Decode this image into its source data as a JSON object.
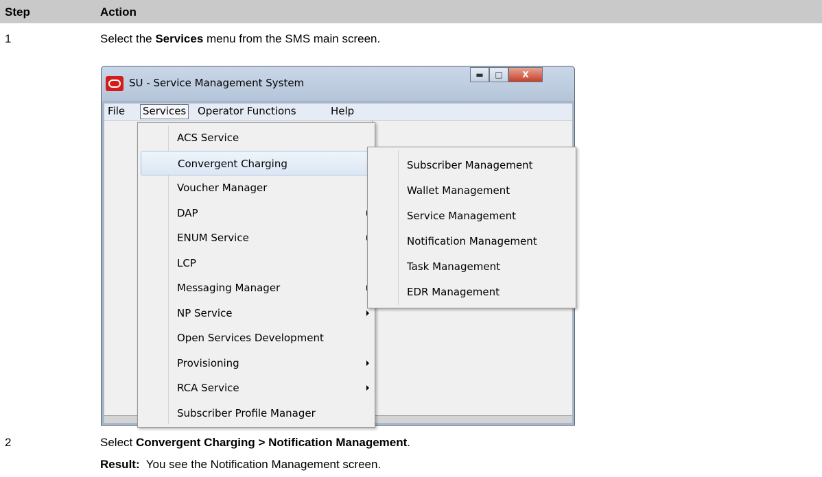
{
  "table": {
    "col_step": "Step",
    "col_action": "Action"
  },
  "steps": [
    {
      "number": "1",
      "pre": "Select the ",
      "bold": "Services",
      "post": " menu from the SMS main screen."
    },
    {
      "number": "2",
      "pre": "Select ",
      "bold": "Convergent Charging > Notification Management",
      "post": "."
    }
  ],
  "result": {
    "label": "Result:",
    "text": "  You see the Notification Management screen."
  },
  "window": {
    "title": "SU - Service Management System",
    "minimize": "▬",
    "maximize": "□",
    "close": "X",
    "menubar": [
      "File",
      "Services",
      "Operator Functions",
      "Help"
    ]
  },
  "services_menu": [
    {
      "label": "ACS Service",
      "submenu": false
    },
    {
      "label": "Convergent Charging",
      "submenu": true,
      "highlighted": true
    },
    {
      "label": "Voucher Manager",
      "submenu": false
    },
    {
      "label": "DAP",
      "submenu": true
    },
    {
      "label": "ENUM Service",
      "submenu": true
    },
    {
      "label": "LCP",
      "submenu": false
    },
    {
      "label": "Messaging Manager",
      "submenu": true
    },
    {
      "label": "NP Service",
      "submenu": true
    },
    {
      "label": "Open Services Development",
      "submenu": false
    },
    {
      "label": "Provisioning",
      "submenu": true
    },
    {
      "label": "RCA Service",
      "submenu": true
    },
    {
      "label": "Subscriber Profile Manager",
      "submenu": false
    }
  ],
  "charging_submenu": [
    "Subscriber Management",
    "Wallet Management",
    "Service Management",
    "Notification Management",
    "Task Management",
    "EDR Management"
  ]
}
